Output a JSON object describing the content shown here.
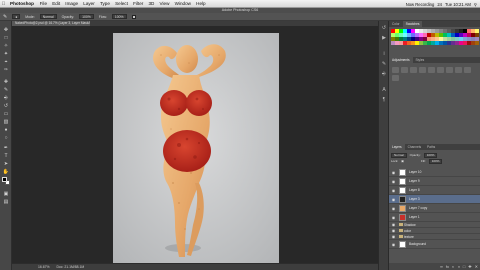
{
  "menubar": {
    "app": "Photoshop",
    "items": [
      "File",
      "Edit",
      "Image",
      "Layer",
      "Type",
      "Select",
      "Filter",
      "3D",
      "View",
      "Window",
      "Help"
    ],
    "status_right": [
      "Now Recording",
      "24",
      "Tue 10:21 AM"
    ]
  },
  "window": {
    "title": "Adobe Photoshop CS6"
  },
  "options": {
    "mode_label": "Mode:",
    "mode_value": "Normal",
    "opacity_label": "Opacity:",
    "opacity_value": "100%",
    "flow_label": "Flow:",
    "flow_value": "100%"
  },
  "document": {
    "tab": "NakedPhoto@2.psd @ 16.7% (Layer 3, Layer Mask/8)"
  },
  "status": {
    "zoom": "16.67%",
    "doc": "Doc: 21.1M/88.1M"
  },
  "panels": {
    "swatch_tabs": [
      "Color",
      "Swatches"
    ],
    "adjust_tabs": [
      "Adjustments",
      "Styles"
    ],
    "layer_tabs": [
      "Layers",
      "Channels",
      "Paths"
    ],
    "blend": "Normal",
    "opacity_label": "Opacity:",
    "opacity_value": "100%",
    "lock_label": "Lock:",
    "fill_label": "Fill:",
    "fill_value": "100%",
    "layers": [
      {
        "name": "Layer 10",
        "selected": false
      },
      {
        "name": "Layer 9",
        "selected": false
      },
      {
        "name": "Layer 8",
        "selected": false
      },
      {
        "name": "Layer 3",
        "selected": true
      },
      {
        "name": "Layer 7 copy",
        "selected": false
      },
      {
        "name": "Layer 1",
        "selected": false
      },
      {
        "name": "Background",
        "selected": false
      }
    ],
    "groups": [
      "Shadow",
      "color",
      "texture"
    ]
  },
  "colors": {
    "accent_selected": "#5a6d8c",
    "pepperoni": "#c8302a",
    "pizza_crust": "#e8a868"
  },
  "swatch_colors": [
    "#ff0000",
    "#ffff00",
    "#00ff00",
    "#00ffff",
    "#0000ff",
    "#ff00ff",
    "#ffffff",
    "#ebebeb",
    "#d6d6d6",
    "#c2c2c2",
    "#adadad",
    "#999999",
    "#858585",
    "#707070",
    "#5c5c5c",
    "#474747",
    "#333333",
    "#1f1f1f",
    "#000000",
    "#ff6c6c",
    "#ffb56c",
    "#fff66c",
    "#b5ff6c",
    "#6cff6c",
    "#6cffb5",
    "#6cffff",
    "#6cb5ff",
    "#6c6cff",
    "#b56cff",
    "#ff6cff",
    "#ff6cb5",
    "#c00000",
    "#c05c00",
    "#c0b800",
    "#5cc000",
    "#00c05c",
    "#00c0c0",
    "#005cc0",
    "#0000c0",
    "#5c00c0",
    "#c000c0",
    "#c0005c",
    "#800000",
    "#804000",
    "#808000",
    "#408000",
    "#008040",
    "#008080",
    "#004080",
    "#000080",
    "#400080",
    "#800080",
    "#800040",
    "#f7977a",
    "#fbad82",
    "#fdc68c",
    "#fff79a",
    "#c4df9b",
    "#a2d39c",
    "#82ca9d",
    "#7bcdc8",
    "#6ecff6",
    "#7ea7d8",
    "#8493ca",
    "#8882be",
    "#a187be",
    "#bc8dbf",
    "#f49ac2",
    "#f6989d",
    "#ed1c24",
    "#f26522",
    "#f7941d",
    "#fff200",
    "#8dc63f",
    "#39b54a",
    "#00a651",
    "#00a99d",
    "#00aeef",
    "#0072bc",
    "#0054a6",
    "#2e3192",
    "#662d91",
    "#92278f",
    "#ec008c",
    "#ed145b",
    "#9e0b0f",
    "#a0410d",
    "#a36209"
  ]
}
